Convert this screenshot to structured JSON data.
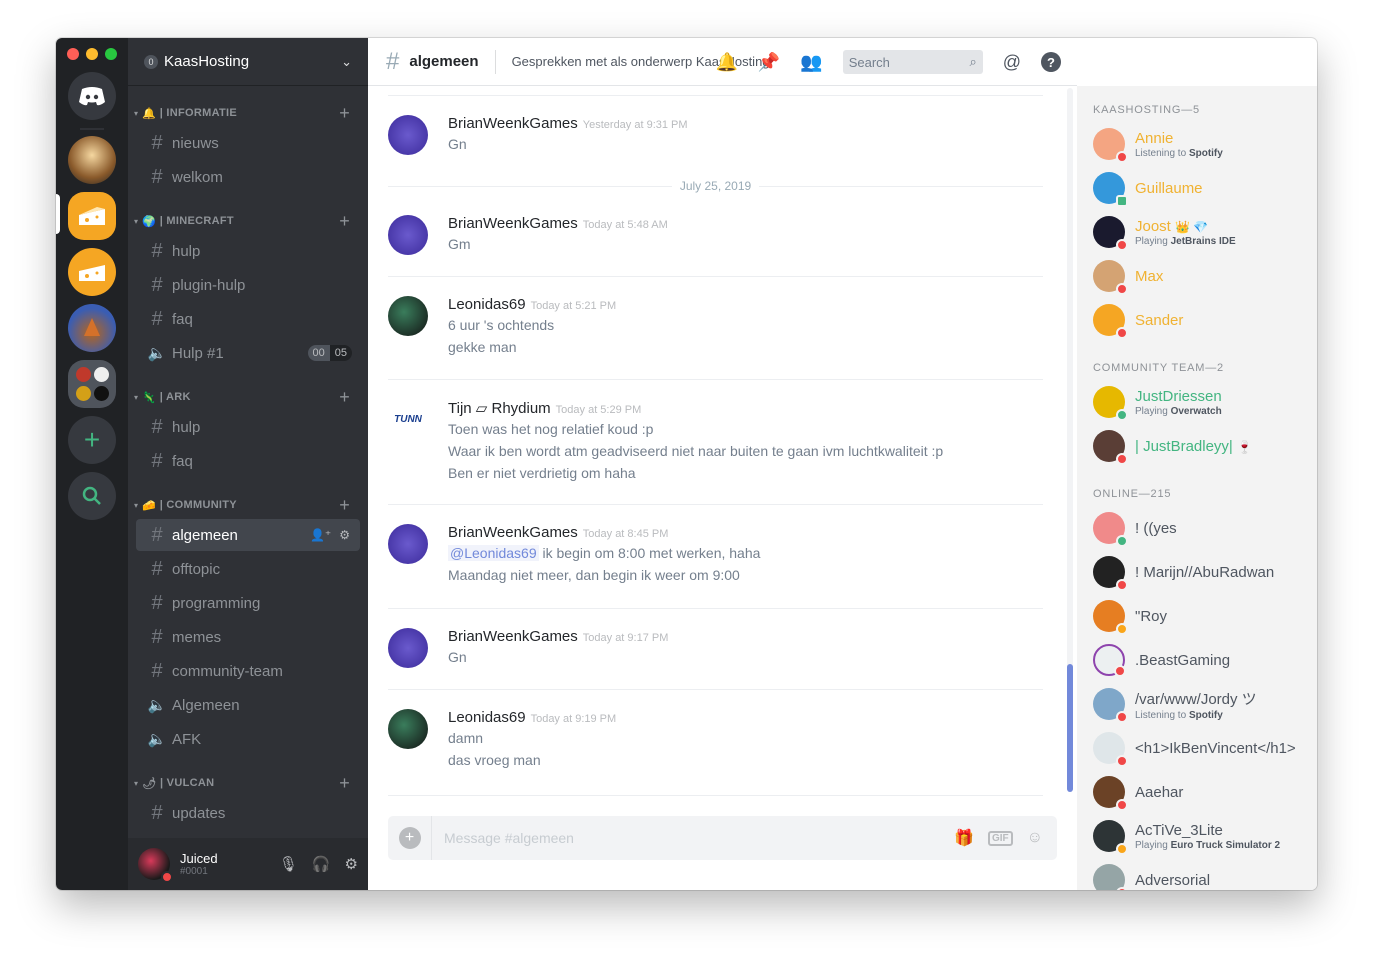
{
  "server": {
    "name": "KaasHosting",
    "badge": "0"
  },
  "categories": [
    {
      "id": "informatie",
      "label": "| INFORMATIE",
      "emoji": "🔔"
    },
    {
      "id": "minecraft",
      "label": "| MINECRAFT",
      "emoji": "🌍"
    },
    {
      "id": "ark",
      "label": "| ARK",
      "emoji": "🦎"
    },
    {
      "id": "community",
      "label": "| COMMUNITY",
      "emoji": "🧀"
    },
    {
      "id": "vulcan",
      "label": "| VULCAN",
      "emoji": "🌶"
    }
  ],
  "channels": [
    {
      "name": "nieuws",
      "type": "text"
    },
    {
      "name": "welkom",
      "type": "text"
    },
    {
      "name": "hulp",
      "type": "text"
    },
    {
      "name": "plugin-hulp",
      "type": "text"
    },
    {
      "name": "faq",
      "type": "text"
    },
    {
      "name": "Hulp #1",
      "type": "voice",
      "timer": [
        "00",
        "05"
      ]
    },
    {
      "name": "hulp",
      "type": "text"
    },
    {
      "name": "faq",
      "type": "text"
    },
    {
      "name": "algemeen",
      "type": "text",
      "active": true
    },
    {
      "name": "offtopic",
      "type": "text"
    },
    {
      "name": "programming",
      "type": "text"
    },
    {
      "name": "memes",
      "type": "text"
    },
    {
      "name": "community-team",
      "type": "text"
    },
    {
      "name": "Algemeen",
      "type": "voice"
    },
    {
      "name": "AFK",
      "type": "voice"
    },
    {
      "name": "updates",
      "type": "text"
    }
  ],
  "user": {
    "name": "Juiced",
    "discriminator": "#0001"
  },
  "chat": {
    "channel": "algemeen",
    "topic": "Gesprekken met als onderwerp KaasHosting.",
    "search_placeholder": "Search",
    "composer_placeholder": "Message #algemeen",
    "gif_label": "GIF",
    "date_divider": "July 25, 2019"
  },
  "messages": [
    {
      "author": "BrianWeenkGames",
      "time": "Yesterday at 9:31 PM",
      "lines": [
        "Gn"
      ]
    },
    {
      "author": "BrianWeenkGames",
      "time": "Today at 5:48 AM",
      "lines": [
        "Gm"
      ]
    },
    {
      "author": "Leonidas69",
      "time": "Today at 5:21 PM",
      "lines": [
        "6 uur 's ochtends",
        "gekke man"
      ]
    },
    {
      "author": "Tijn ▱ Rhydium",
      "time": "Today at 5:29 PM",
      "lines": [
        "Toen was het nog relatief koud :p",
        "Waar ik ben wordt atm geadviseerd niet naar buiten te gaan ivm luchtkwaliteit :p",
        "Ben er niet verdrietig om haha"
      ]
    },
    {
      "author": "BrianWeenkGames",
      "time": "Today at 8:45 PM",
      "mention": "@Leonidas69",
      "lines": [
        " ik begin om 8:00 met werken, haha",
        "Maandag niet meer, dan begin ik weer om 9:00"
      ]
    },
    {
      "author": "BrianWeenkGames",
      "time": "Today at 9:17 PM",
      "lines": [
        "Gn"
      ]
    },
    {
      "author": "Leonidas69",
      "time": "Today at 9:19 PM",
      "lines": [
        "damn",
        "das vroeg man"
      ]
    }
  ],
  "member_groups": [
    {
      "label": "KAASHOSTING—5"
    },
    {
      "label": "COMMUNITY TEAM—2"
    },
    {
      "label": "ONLINE—215"
    }
  ],
  "members": [
    {
      "name": "Annie",
      "activity_prefix": "Listening to",
      "activity": "Spotify",
      "status": "dnd"
    },
    {
      "name": "Guillaume",
      "status": "mobile"
    },
    {
      "name": "Joost",
      "badges": "👑 💎",
      "activity_prefix": "Playing",
      "activity": "JetBrains IDE",
      "status": "dnd"
    },
    {
      "name": "Max",
      "status": "dnd"
    },
    {
      "name": "Sander",
      "status": "dnd"
    },
    {
      "name": "JustDriessen",
      "activity_prefix": "Playing",
      "activity": "Overwatch",
      "status": "on"
    },
    {
      "name": "| JustBradleyy|",
      "badges": "🍷",
      "status": "dnd"
    },
    {
      "name": "! ((yes",
      "status": "on"
    },
    {
      "name": "! Marijn//AbuRadwan",
      "status": "dnd"
    },
    {
      "name": "\"Roy",
      "status": "idle"
    },
    {
      "name": ".BeastGaming",
      "status": "dnd"
    },
    {
      "name": "/var/www/Jordy ツ",
      "activity_prefix": "Listening to",
      "activity": "Spotify",
      "status": "dnd"
    },
    {
      "name": "<h1>IkBenVincent</h1>",
      "status": "dnd"
    },
    {
      "name": "Aaehar",
      "status": "dnd"
    },
    {
      "name": "AcTiVe_3Lite",
      "activity_prefix": "Playing",
      "activity": "Euro Truck Simulator 2",
      "status": "idle"
    },
    {
      "name": "Adversorial",
      "status": "dnd"
    }
  ],
  "colors": {
    "accent": "#7289da",
    "online": "#43b581",
    "dnd": "#f04747",
    "idle": "#faa61a",
    "staff": "#f0b232"
  }
}
